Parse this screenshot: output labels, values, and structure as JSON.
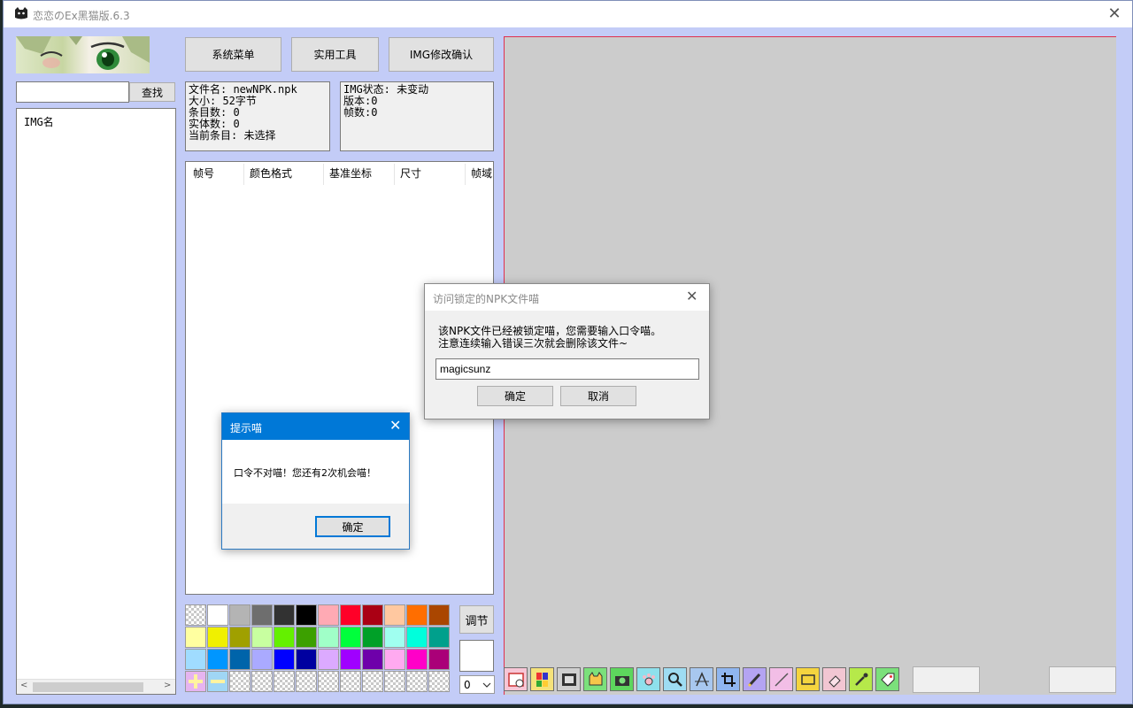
{
  "window": {
    "title": "恋恋のEx黑猫版.6.3",
    "close_glyph": "✕"
  },
  "top_buttons": {
    "system_menu": "系统菜单",
    "tools": "实用工具",
    "img_confirm": "IMG修改确认"
  },
  "search": {
    "value": "",
    "button": "查找"
  },
  "img_list": {
    "header": "IMG名"
  },
  "file_info": {
    "filename": "文件名: newNPK.npk",
    "size": "大小: 52字节",
    "entries": "条目数: 0",
    "entities": "实体数: 0",
    "current": "当前条目: 未选择"
  },
  "img_info": {
    "status": "IMG状态: 未变动",
    "version": "版本:0",
    "frames": "帧数:0"
  },
  "frame_table": {
    "columns": [
      "帧号",
      "颜色格式",
      "基准坐标",
      "尺寸",
      "帧域"
    ]
  },
  "palette": {
    "rows": [
      [
        "checker",
        "#ffffff",
        "#b4b4b4",
        "#6e6e6e",
        "#323232",
        "#000000",
        "#ffaab4",
        "#ff0028",
        "#aa0014",
        "#ffc8a0",
        "#ff6e00",
        "#aa4600"
      ],
      [
        "#ffffa0",
        "#f0f000",
        "#a0a000",
        "#c8ffa0",
        "#64f000",
        "#3ca000",
        "#a0ffc8",
        "#00ff3c",
        "#00a028",
        "#a0fff0",
        "#00ffdc",
        "#00a08c"
      ],
      [
        "#a0dcff",
        "#0096ff",
        "#0064aa",
        "#aaaaff",
        "#0000ff",
        "#0000a0",
        "#dcaaff",
        "#a000ff",
        "#6e00aa",
        "#ffaaf0",
        "#ff00c8",
        "#aa0078"
      ],
      [
        "add",
        "remove",
        "checker",
        "checker",
        "checker",
        "checker",
        "checker",
        "checker",
        "checker",
        "checker",
        "checker",
        "checker"
      ]
    ]
  },
  "adjust_button": "调节",
  "zoom_select": {
    "value": "0"
  },
  "toolbar": {
    "tools": [
      "frame-properties-icon",
      "color-palette-icon",
      "film-strip-icon",
      "cat-face-icon",
      "camera-icon",
      "paw-icon",
      "magnifier-icon",
      "align-icon",
      "crop-icon",
      "pencil-icon",
      "line-icon",
      "rectangle-icon",
      "eraser-icon",
      "eyedropper-icon",
      "tag-icon"
    ]
  },
  "password_dialog": {
    "title": "访问锁定的NPK文件喵",
    "message_line1": "该NPK文件已经被锁定喵，您需要输入口令喵。",
    "message_line2": "注意连续输入错误三次就会删除该文件~",
    "password_value": "magicsunz",
    "ok": "确定",
    "cancel": "取消",
    "close_glyph": "✕"
  },
  "alert_dialog": {
    "title": "提示喵",
    "message": "口令不对喵！您还有2次机会喵！",
    "ok": "确定",
    "close_glyph": "✕"
  },
  "colors": {
    "title_bar_blue": "#0078d7",
    "window_bg": "#c3ccf7",
    "canvas_bg": "#cccccc",
    "canvas_border": "#e0304f"
  }
}
